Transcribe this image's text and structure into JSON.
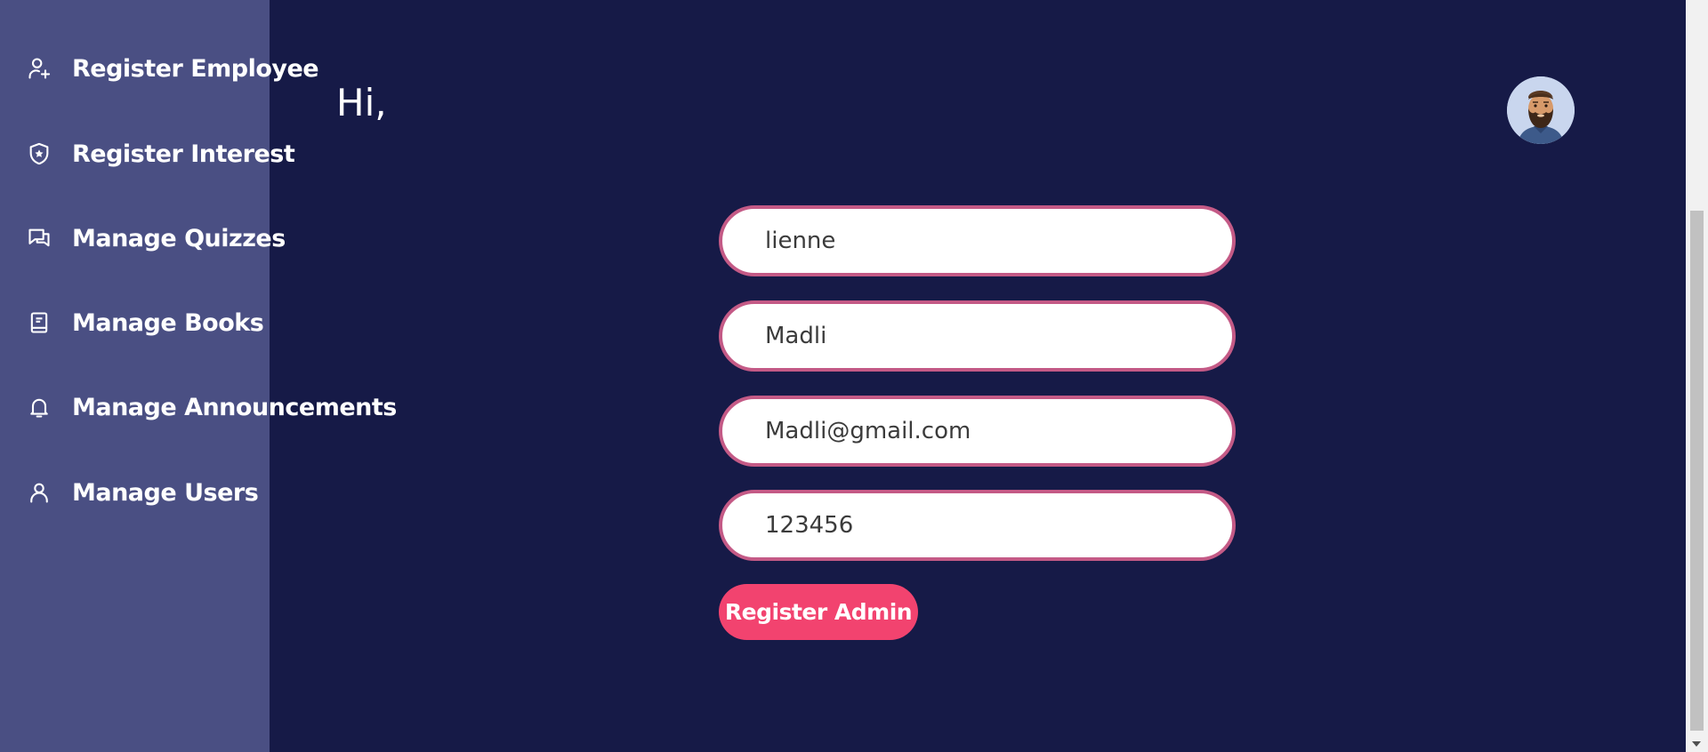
{
  "sidebar": {
    "items": [
      {
        "label": "Register Employee",
        "icon": "user-plus-icon"
      },
      {
        "label": "Register Interest",
        "icon": "shield-star-icon"
      },
      {
        "label": "Manage Quizzes",
        "icon": "chat-bubbles-icon"
      },
      {
        "label": "Manage Books",
        "icon": "book-icon"
      },
      {
        "label": "Manage Announcements",
        "icon": "bell-icon"
      },
      {
        "label": "Manage Users",
        "icon": "user-icon"
      }
    ]
  },
  "header": {
    "greeting": "Hi,"
  },
  "form": {
    "first_name": "lienne",
    "last_name": "Madli",
    "email": "Madli@gmail.com",
    "password": "123456",
    "submit_label": "Register Admin"
  },
  "colors": {
    "sidebar_bg": "#4a4f83",
    "main_bg": "#161a47",
    "field_border": "#c45a86",
    "button_bg": "#f2436f"
  }
}
